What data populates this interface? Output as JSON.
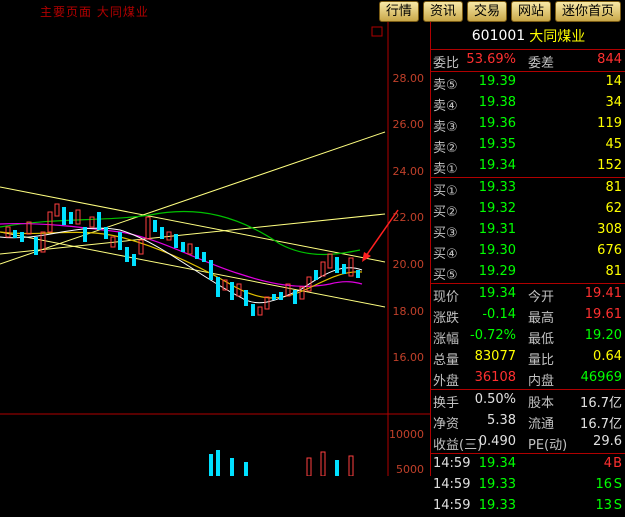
{
  "topbar": {
    "title": "主要页面 大同煤业",
    "tabs": [
      "行情",
      "资讯",
      "交易",
      "网站",
      "迷你首页"
    ]
  },
  "chart": {
    "y_labels": [
      "28.00",
      "26.00",
      "24.00",
      "22.00",
      "20.00",
      "18.00",
      "16.00"
    ],
    "vol_labels": [
      "10000",
      "5000"
    ]
  },
  "quote": {
    "code": "601001",
    "name": "大同煤业",
    "weibi_label": "委比",
    "weibi_value": "53.69%",
    "weicha_label": "委差",
    "weicha_value": "844",
    "sell": [
      {
        "label": "卖⑤",
        "price": "19.39",
        "vol": "14"
      },
      {
        "label": "卖④",
        "price": "19.38",
        "vol": "34"
      },
      {
        "label": "卖③",
        "price": "19.36",
        "vol": "119"
      },
      {
        "label": "卖②",
        "price": "19.35",
        "vol": "45"
      },
      {
        "label": "卖①",
        "price": "19.34",
        "vol": "152"
      }
    ],
    "buy": [
      {
        "label": "买①",
        "price": "19.33",
        "vol": "81"
      },
      {
        "label": "买②",
        "price": "19.32",
        "vol": "62"
      },
      {
        "label": "买③",
        "price": "19.31",
        "vol": "308"
      },
      {
        "label": "买④",
        "price": "19.30",
        "vol": "676"
      },
      {
        "label": "买⑤",
        "price": "19.29",
        "vol": "81"
      }
    ],
    "stats": [
      {
        "l1": "现价",
        "v1": "19.34",
        "l2": "今开",
        "v2": "19.41"
      },
      {
        "l1": "涨跌",
        "v1": "-0.14",
        "l2": "最高",
        "v2": "19.61"
      },
      {
        "l1": "涨幅",
        "v1": "-0.72%",
        "l2": "最低",
        "v2": "19.20"
      },
      {
        "l1": "总量",
        "v1": "83077",
        "l2": "量比",
        "v2": "0.64"
      },
      {
        "l1": "外盘",
        "v1": "36108",
        "l2": "内盘",
        "v2": "46969"
      }
    ],
    "info": [
      {
        "l1": "换手",
        "v1": "0.50%",
        "l2": "股本",
        "v2": "16.7亿"
      },
      {
        "l1": "净资",
        "v1": "5.38",
        "l2": "流通",
        "v2": "16.7亿"
      },
      {
        "l1": "收益(三)",
        "v1": "0.490",
        "l2": "PE(动)",
        "v2": "29.6"
      }
    ],
    "ticks": [
      {
        "time": "14:59",
        "price": "19.34",
        "vol": "4",
        "side": "B"
      },
      {
        "time": "14:59",
        "price": "19.33",
        "vol": "16",
        "side": "S"
      },
      {
        "time": "14:59",
        "price": "19.33",
        "vol": "13",
        "side": "S"
      }
    ]
  }
}
